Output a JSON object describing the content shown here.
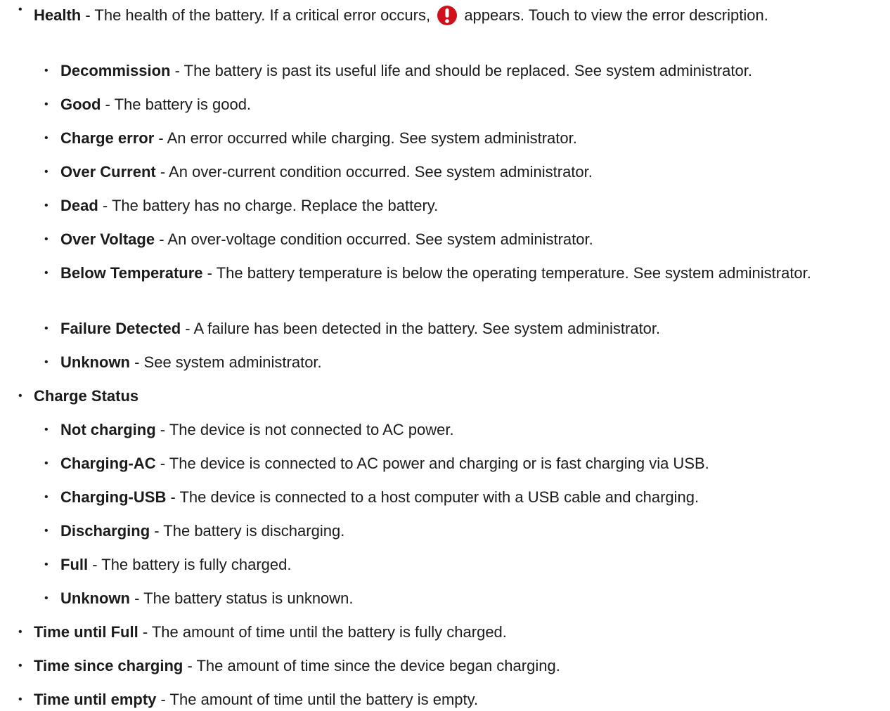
{
  "health": {
    "term": "Health",
    "desc_before_icon": " - The health of the battery. If a critical error occurs, ",
    "icon": "critical-error-icon",
    "desc_after_icon": " appears. Touch to view the error description.",
    "items": [
      {
        "term": "Decommission",
        "desc": " - The battery is past its useful life and should be replaced. See system administrator."
      },
      {
        "term": "Good",
        "desc": " - The battery is good."
      },
      {
        "term": "Charge error",
        "desc": " - An error occurred while charging. See system administrator."
      },
      {
        "term": "Over Current",
        "desc": " - An over-current condition occurred. See system administrator."
      },
      {
        "term": "Dead",
        "desc": " - The battery has no charge. Replace the battery."
      },
      {
        "term": "Over Voltage",
        "desc": " - An over-voltage condition occurred. See system administrator."
      },
      {
        "term": "Below Temperature",
        "desc": " - The battery temperature is below the operating temperature. See system administrator."
      },
      {
        "term": "Failure Detected",
        "desc": " - A failure has been detected in the battery. See system administrator."
      },
      {
        "term": "Unknown",
        "desc": " - See system administrator."
      }
    ]
  },
  "charge_status": {
    "term": "Charge Status",
    "items": [
      {
        "term": "Not charging",
        "desc": " - The device is not connected to AC power."
      },
      {
        "term": "Charging-AC",
        "desc": " - The device is connected to AC power and charging or is fast charging via USB."
      },
      {
        "term": "Charging-USB",
        "desc": " - The device is connected to a host computer with a USB cable and charging."
      },
      {
        "term": "Discharging",
        "desc": " - The battery is discharging."
      },
      {
        "term": "Full",
        "desc": " - The battery is fully charged."
      },
      {
        "term": "Unknown",
        "desc": " - The battery status is unknown."
      }
    ]
  },
  "time_items": [
    {
      "term": "Time until Full",
      "desc": " - The amount of time until the battery is fully charged."
    },
    {
      "term": "Time since charging",
      "desc": " - The amount of time since the device began charging."
    },
    {
      "term": "Time until empty",
      "desc": " - The amount of time until the battery is empty."
    }
  ],
  "colors": {
    "error_icon": "#d0101b",
    "text": "#1b1b1b"
  }
}
